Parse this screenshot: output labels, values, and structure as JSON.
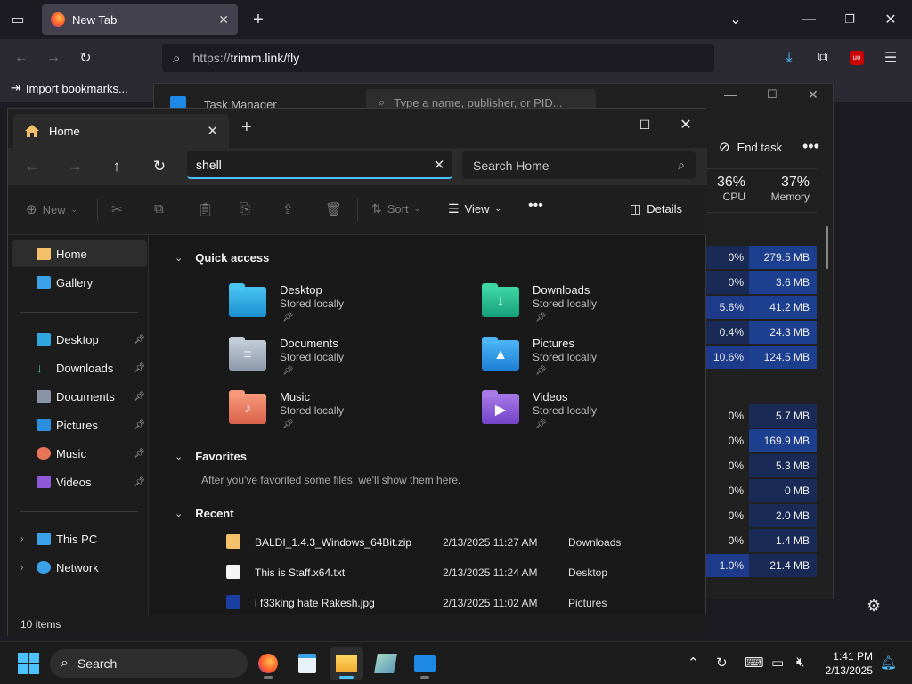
{
  "browser": {
    "tab_title": "New Tab",
    "url_scheme": "https://",
    "url_rest": "trimm.link/fly",
    "bookmark_import": "Import bookmarks..."
  },
  "task_manager": {
    "title": "Task Manager",
    "search_placeholder": "Type a name, publisher, or PID...",
    "end_task": "End task",
    "cpu_pct": "36%",
    "cpu_label": "CPU",
    "mem_pct": "37%",
    "mem_label": "Memory",
    "rows": [
      {
        "cpu": "0%",
        "mem": "279.5 MB"
      },
      {
        "cpu": "0%",
        "mem": "3.6 MB"
      },
      {
        "cpu": "5.6%",
        "mem": "41.2 MB"
      },
      {
        "cpu": "0.4%",
        "mem": "24.3 MB"
      },
      {
        "cpu": "10.6%",
        "mem": "124.5 MB"
      },
      {
        "cpu": "",
        "mem": ""
      },
      {
        "cpu": "0%",
        "mem": "5.7 MB"
      },
      {
        "cpu": "0%",
        "mem": "169.9 MB"
      },
      {
        "cpu": "0%",
        "mem": "5.3 MB"
      },
      {
        "cpu": "0%",
        "mem": "0 MB"
      },
      {
        "cpu": "0%",
        "mem": "2.0 MB"
      },
      {
        "cpu": "0%",
        "mem": "1.4 MB"
      },
      {
        "cpu": "1.0%",
        "mem": "21.4 MB"
      }
    ]
  },
  "explorer": {
    "tab_title": "Home",
    "search_value": "shell",
    "search_home_placeholder": "Search Home",
    "toolbar": {
      "new_label": "New",
      "sort_label": "Sort",
      "view_label": "View",
      "details_label": "Details"
    },
    "sidebar": {
      "home": "Home",
      "gallery": "Gallery",
      "desktop": "Desktop",
      "downloads": "Downloads",
      "documents": "Documents",
      "pictures": "Pictures",
      "music": "Music",
      "videos": "Videos",
      "this_pc": "This PC",
      "network": "Network"
    },
    "sections": {
      "quick_access": "Quick access",
      "favorites": "Favorites",
      "favorites_note": "After you've favorited some files, we'll show them here.",
      "recent": "Recent"
    },
    "quick_access": [
      {
        "name": "Desktop",
        "sub": "Stored locally"
      },
      {
        "name": "Downloads",
        "sub": "Stored locally"
      },
      {
        "name": "Documents",
        "sub": "Stored locally"
      },
      {
        "name": "Pictures",
        "sub": "Stored locally"
      },
      {
        "name": "Music",
        "sub": "Stored locally"
      },
      {
        "name": "Videos",
        "sub": "Stored locally"
      }
    ],
    "recent": [
      {
        "name": "BALDI_1.4.3_Windows_64Bit.zip",
        "date": "2/13/2025 11:27 AM",
        "location": "Downloads"
      },
      {
        "name": "This is Staff.x64.txt",
        "date": "2/13/2025 11:24 AM",
        "location": "Desktop"
      },
      {
        "name": "i f33king hate Rakesh.jpg",
        "date": "2/13/2025 11:02 AM",
        "location": "Pictures"
      }
    ],
    "status": "10 items"
  },
  "taskbar": {
    "search_label": "Search",
    "time": "1:41 PM",
    "date": "2/13/2025"
  },
  "colors": {
    "accent": "#4cc2ff",
    "tm_cpu_bar": "#1e3a8a",
    "tm_mem_bar": "#1d3f8f"
  }
}
